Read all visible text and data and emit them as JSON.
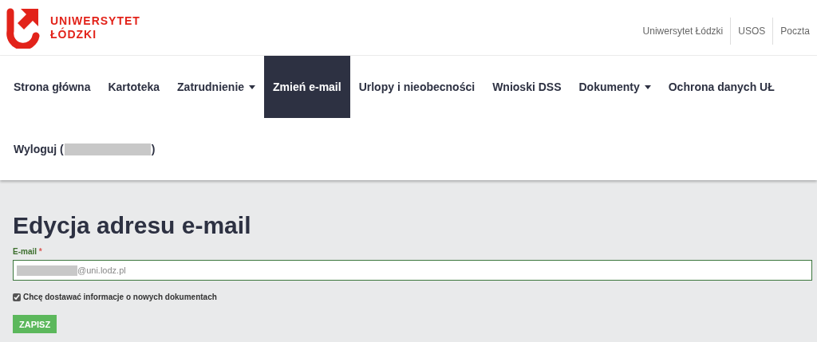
{
  "logo": {
    "lines": [
      "UNIWERSYTET",
      "ŁÓDZKI"
    ]
  },
  "top_links": [
    "Uniwersytet Łódzki",
    "USOS",
    "Poczta"
  ],
  "nav": [
    {
      "label": "Strona główna",
      "selected": false,
      "kind": "link"
    },
    {
      "label": "Kartoteka",
      "selected": false,
      "kind": "link"
    },
    {
      "label": "Zatrudnienie",
      "selected": false,
      "kind": "dropdown"
    },
    {
      "label": "Zmień e-mail",
      "selected": true,
      "kind": "link"
    },
    {
      "label": "Urlopy i nieobecności",
      "selected": false,
      "kind": "link"
    },
    {
      "label": "Wnioski DSS",
      "selected": false,
      "kind": "link"
    },
    {
      "label": "Dokumenty",
      "selected": false,
      "kind": "dropdown"
    },
    {
      "label": "Ochrona danych UŁ",
      "selected": false,
      "kind": "link"
    },
    {
      "label": "Wyloguj (",
      "suffix": ")",
      "selected": false,
      "kind": "redacted"
    }
  ],
  "page_title": "Edycja adresu e-mail",
  "email": {
    "label": "E-mail",
    "required": true,
    "required_mark": "*",
    "value": "@uni.lodz.pl"
  },
  "subscribe": {
    "label": "Chcę dostawać informacje o nowych dokumentach",
    "checked": true
  },
  "submit": "ZAPISZ"
}
